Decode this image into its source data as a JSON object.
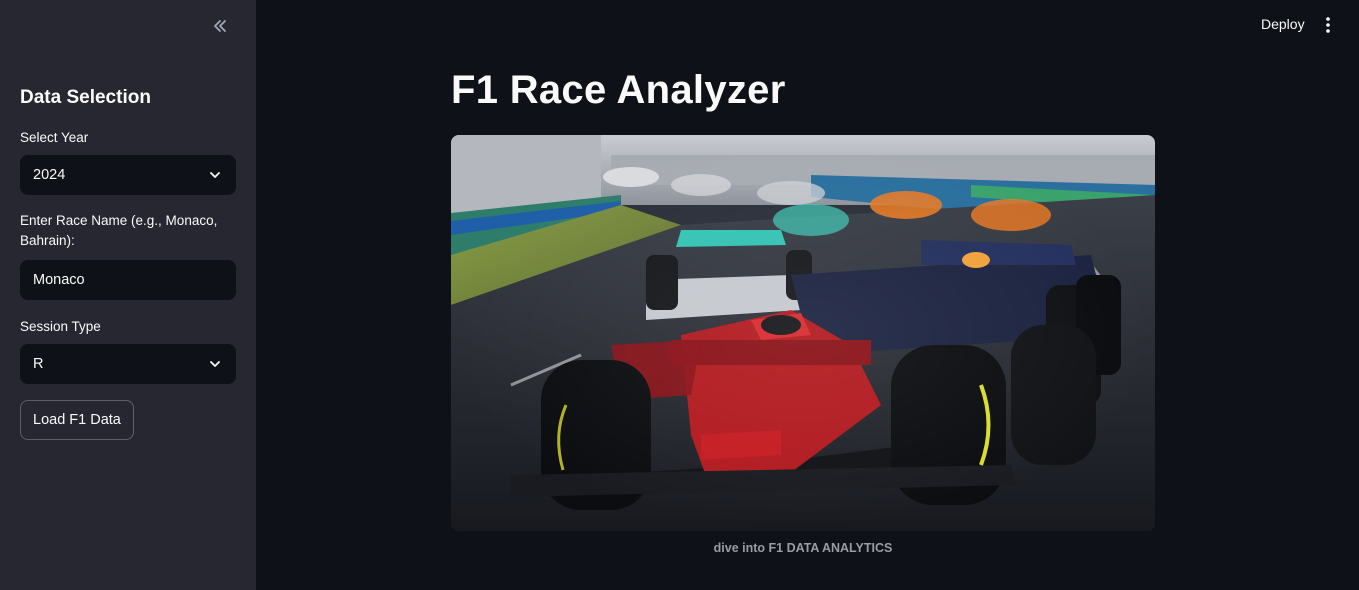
{
  "sidebar": {
    "collapse_icon": "double-chevron-left-icon",
    "title": "Data Selection",
    "year": {
      "label": "Select Year",
      "value": "2024"
    },
    "race": {
      "label": "Enter Race Name (e.g., Monaco, Bahrain):",
      "value": "Monaco"
    },
    "session": {
      "label": "Session Type",
      "value": "R"
    },
    "load_button": "Load F1 Data"
  },
  "header": {
    "deploy_label": "Deploy",
    "menu_icon": "kebab-menu-icon"
  },
  "main": {
    "title": "F1 Race Analyzer",
    "image_alt": "Formula 1 cars racing on track",
    "caption": "dive into F1 DATA ANALYTICS"
  }
}
